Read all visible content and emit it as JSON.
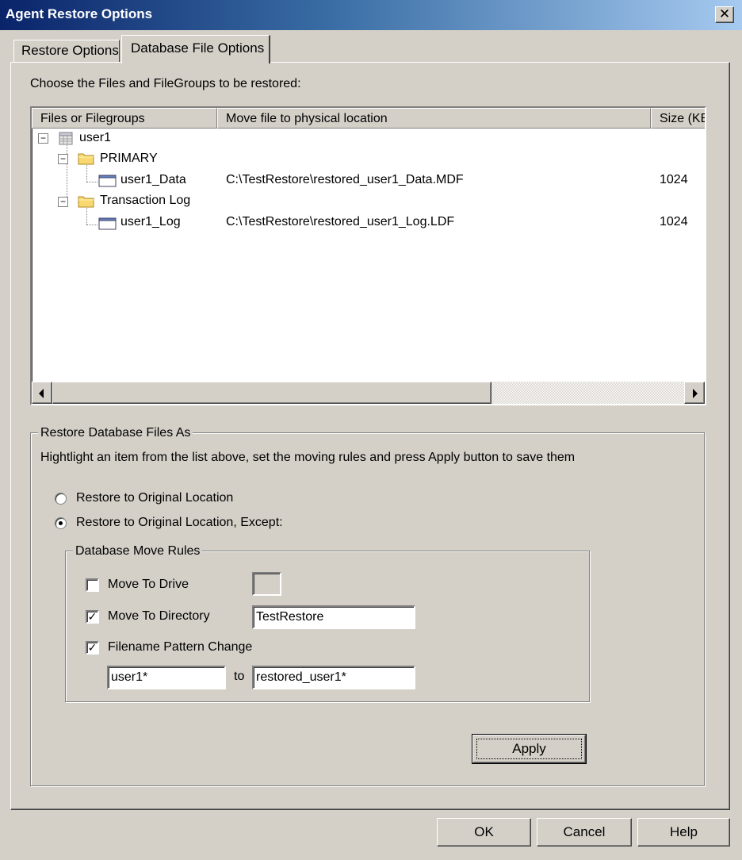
{
  "window": {
    "title": "Agent Restore Options",
    "close_glyph": "✕"
  },
  "tabs": [
    {
      "label": "Restore Options",
      "active": false
    },
    {
      "label": "Database File Options",
      "active": true
    }
  ],
  "instructions": "Choose the Files and FileGroups to be restored:",
  "file_list": {
    "columns": [
      "Files or Filegroups",
      "Move file to physical location",
      "Size (KB)"
    ],
    "expander_glyph": "−",
    "database": {
      "name": "user1",
      "icon": "database-icon"
    },
    "filegroups": [
      {
        "name": "PRIMARY",
        "icon": "folder-icon",
        "files": [
          {
            "name": "user1_Data",
            "path": "C:\\TestRestore\\restored_user1_Data.MDF",
            "size": "1024",
            "icon": "file-icon"
          }
        ]
      },
      {
        "name": "Transaction Log",
        "icon": "folder-icon",
        "files": [
          {
            "name": "user1_Log",
            "path": "C:\\TestRestore\\restored_user1_Log.LDF",
            "size": "1024",
            "icon": "file-icon"
          }
        ]
      }
    ]
  },
  "restore_group": {
    "title": "Restore Database Files As",
    "hint": "Hightlight an item from the list above, set the moving rules and press Apply button to save them",
    "options": [
      {
        "label": "Restore to Original Location",
        "selected": false
      },
      {
        "label": "Restore to Original Location, Except:",
        "selected": true
      }
    ]
  },
  "move_rules": {
    "title": "Database Move Rules",
    "move_to_drive": {
      "label": "Move To Drive",
      "checked": false,
      "value": ""
    },
    "move_to_directory": {
      "label": "Move To Directory",
      "checked": true,
      "value": "TestRestore"
    },
    "filename_pattern": {
      "label": "Filename Pattern Change",
      "checked": true,
      "from": "user1*",
      "to_label": "to",
      "to": "restored_user1*"
    },
    "check_glyph": "✓"
  },
  "buttons": {
    "apply": "Apply",
    "ok": "OK",
    "cancel": "Cancel",
    "help": "Help"
  }
}
